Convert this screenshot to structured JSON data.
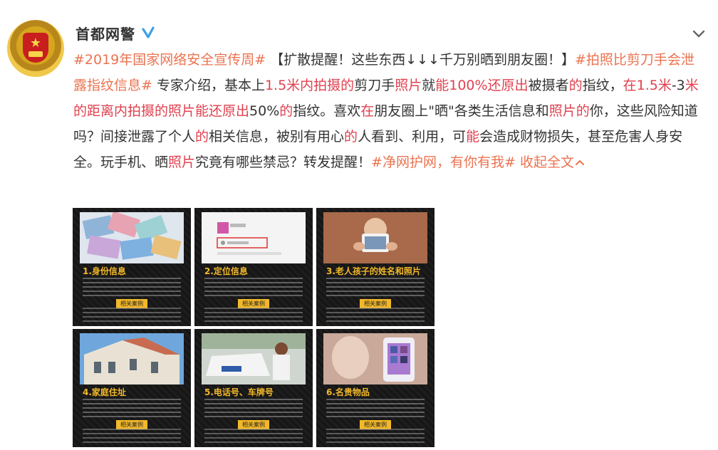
{
  "account": {
    "name": "首都网警",
    "verified": true
  },
  "post": {
    "segments": [
      {
        "t": "#2019年国家网络安全宣传周#",
        "c": "topic"
      },
      {
        "t": " 【扩散提醒！这些东西↓↓↓千万别晒到朋友圈！】",
        "c": ""
      },
      {
        "t": "#拍照比剪刀手会泄露指纹信息#",
        "c": "topic"
      },
      {
        "t": " 专家介绍，基本上",
        "c": ""
      },
      {
        "t": "1.5米内拍摄的",
        "c": "hl"
      },
      {
        "t": "剪刀手",
        "c": ""
      },
      {
        "t": "照片",
        "c": "hl"
      },
      {
        "t": "就",
        "c": ""
      },
      {
        "t": "能100%还原出",
        "c": "hl"
      },
      {
        "t": "被摄者",
        "c": ""
      },
      {
        "t": "的",
        "c": "hl"
      },
      {
        "t": "指纹，",
        "c": ""
      },
      {
        "t": "在1.5米",
        "c": "hl"
      },
      {
        "t": "-3",
        "c": ""
      },
      {
        "t": "米的距离内拍摄的照片能还原出",
        "c": "hl"
      },
      {
        "t": "50%",
        "c": ""
      },
      {
        "t": "的",
        "c": "hl"
      },
      {
        "t": "指纹。喜欢",
        "c": ""
      },
      {
        "t": "在",
        "c": "hl"
      },
      {
        "t": "朋友圈上\"晒\"各类生活信息和",
        "c": ""
      },
      {
        "t": "照片的",
        "c": "hl"
      },
      {
        "t": "你，这些风险知道吗？间接泄露了个人",
        "c": ""
      },
      {
        "t": "的",
        "c": "hl"
      },
      {
        "t": "相关信息，被别有用心",
        "c": ""
      },
      {
        "t": "的",
        "c": "hl"
      },
      {
        "t": "人看到、利用，可",
        "c": ""
      },
      {
        "t": "能",
        "c": "hl"
      },
      {
        "t": "会造成财物损失，甚至危害人身安全。玩手机、晒",
        "c": ""
      },
      {
        "t": "照片",
        "c": "hl"
      },
      {
        "t": "究竟有哪些禁忌？转发提醒！",
        "c": ""
      },
      {
        "t": "#净网护网，有你有我#",
        "c": "topic"
      }
    ],
    "collapse_label": "收起全文"
  },
  "images": [
    {
      "title": "1.身份信息",
      "tag": "相关案例"
    },
    {
      "title": "2.定位信息",
      "tag": "相关案例"
    },
    {
      "title": "3.老人孩子的姓名和照片",
      "tag": "相关案例"
    },
    {
      "title": "4.家庭住址",
      "tag": "相关案例"
    },
    {
      "title": "5.电话号、车牌号",
      "tag": "相关案例"
    },
    {
      "title": "6.名贵物品",
      "tag": "相关案例"
    }
  ],
  "colors": {
    "topic": "#eb7350",
    "highlight": "#e0414f",
    "verified": "#3aa0e6",
    "thumb_title": "#f3b829"
  },
  "icons": {
    "verified": "verified-badge-icon",
    "dropdown": "chevron-down-icon"
  }
}
